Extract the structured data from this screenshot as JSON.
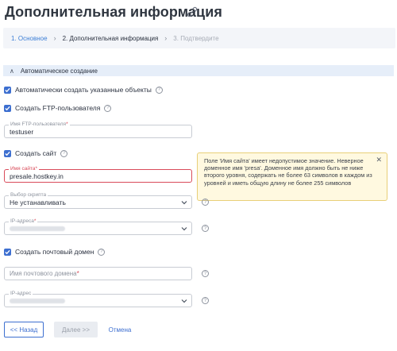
{
  "page": {
    "title": "Дополнительная информация"
  },
  "steps": [
    {
      "label": "1. Основное"
    },
    {
      "label": "2. Дополнительная информация"
    },
    {
      "label": "3. Подтвердите"
    }
  ],
  "section": {
    "title": "Автоматическое создание"
  },
  "checkboxes": {
    "auto_create": "Автоматически создать указанные объекты",
    "ftp_user": "Создать FTP-пользователя",
    "site": "Создать сайт",
    "mail_domain": "Создать почтовый домен"
  },
  "fields": {
    "ftp_user_name": {
      "label": "Имя FTP-пользователя",
      "value": "testuser"
    },
    "site_name": {
      "label": "Имя сайта",
      "value": "presale.hostkey.in"
    },
    "script_select": {
      "label": "Выбор скрипта",
      "value": "Не устанавливать"
    },
    "ip_address": {
      "label": "IP-адреса"
    },
    "mail_domain_name": {
      "placeholder": "Имя почтового домена"
    },
    "ip_address2": {
      "label": "IP-адрес"
    }
  },
  "tooltip": {
    "text": "Поле 'Имя сайта' имеет недопустимое значение. Неверное доменное имя 'presa'. Доменное имя должно быть не ниже второго уровня, содержать не более 63 символов в каждом из уровней и иметь общую длину не более 255 символов"
  },
  "buttons": {
    "back": "<< Назад",
    "next": "Далее >>",
    "cancel": "Отмена"
  },
  "colors": {
    "accent": "#3d6fd0",
    "error": "#d94b5a",
    "tooltip_bg": "#fff9e0"
  },
  "icons": [
    "link-icon",
    "chevron-right-icon",
    "chevron-up-icon",
    "checkmark-icon",
    "help-icon",
    "chevron-down-icon",
    "close-icon"
  ]
}
